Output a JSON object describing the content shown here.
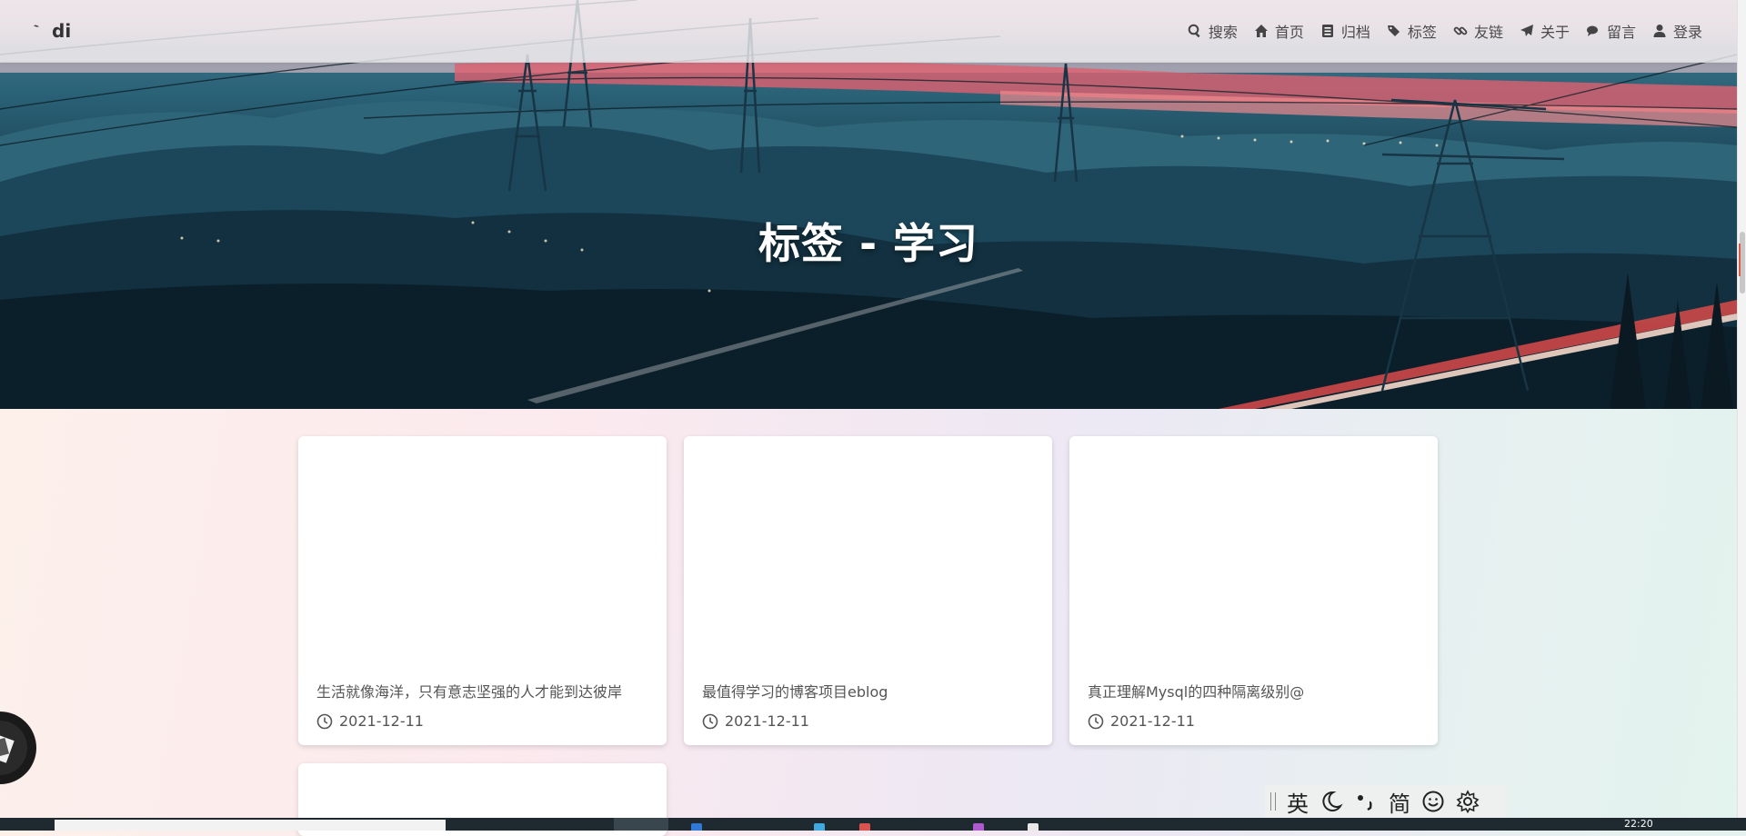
{
  "site": {
    "brand": "di"
  },
  "nav": {
    "items": [
      {
        "label": "搜索",
        "icon": "search-icon"
      },
      {
        "label": "首页",
        "icon": "home-icon"
      },
      {
        "label": "归档",
        "icon": "archive-icon"
      },
      {
        "label": "标签",
        "icon": "tags-icon"
      },
      {
        "label": "友链",
        "icon": "link-icon"
      },
      {
        "label": "关于",
        "icon": "paper-plane-icon"
      },
      {
        "label": "留言",
        "icon": "comments-icon"
      },
      {
        "label": "登录",
        "icon": "user-icon"
      }
    ]
  },
  "hero": {
    "title": "标签 - 学习"
  },
  "posts": [
    {
      "title": "生活就像海洋，只有意志坚强的人才能到达彼岸",
      "date": "2021-12-11"
    },
    {
      "title": "最值得学习的博客项目eblog",
      "date": "2021-12-11"
    },
    {
      "title": "真正理解Mysql的四种隔离级别@",
      "date": "2021-12-11"
    },
    {
      "title": "",
      "date": ""
    }
  ],
  "ime": {
    "mode": "英",
    "charset": "简",
    "moon_icon": "moon-icon",
    "punct_icon": "punctuation-icon",
    "emoji_icon": "emoji-icon",
    "settings_icon": "gear-icon"
  },
  "taskbar": {
    "clock": "22:20"
  },
  "colors": {
    "accent": "#e05a4a",
    "card_bg": "#ffffff",
    "nav_bg": "#ececee"
  }
}
